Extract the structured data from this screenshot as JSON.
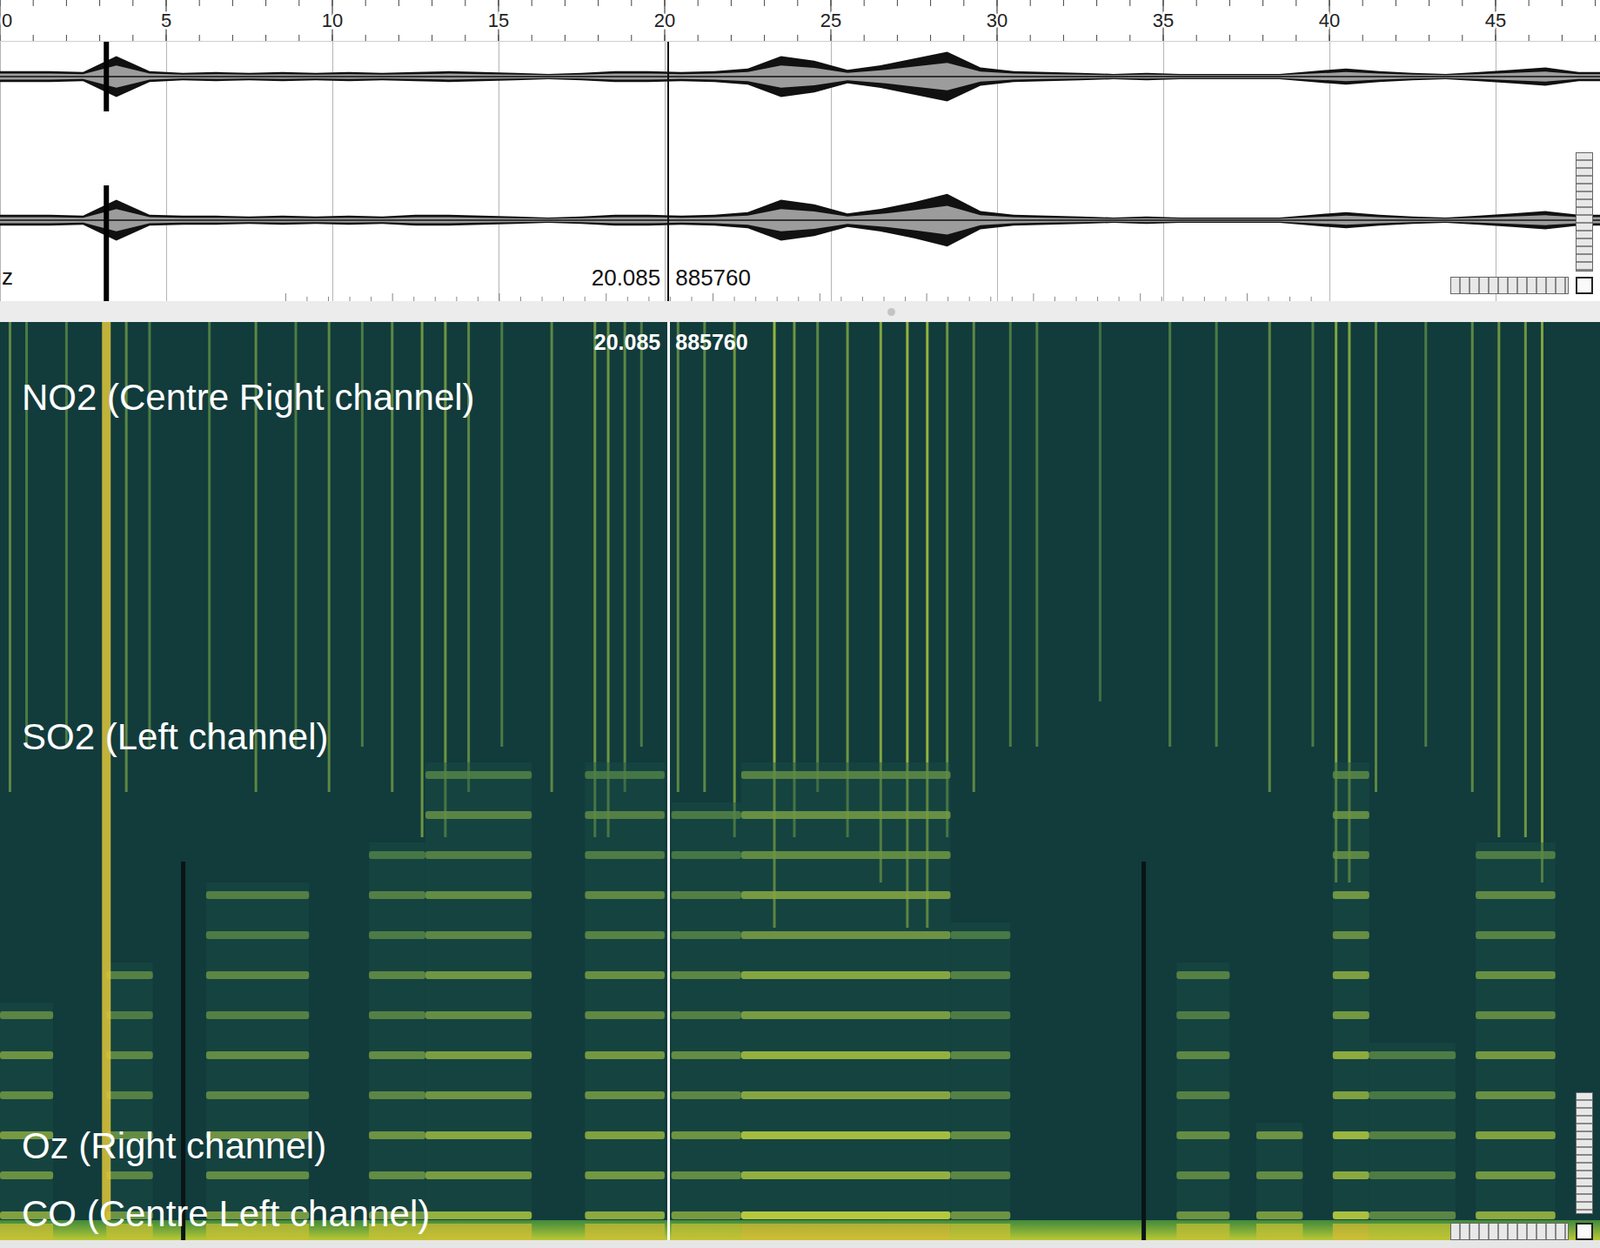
{
  "ruler": {
    "ticks": [
      {
        "label": "0",
        "time": 0
      },
      {
        "label": "5",
        "time": 5
      },
      {
        "label": "10",
        "time": 10
      },
      {
        "label": "15",
        "time": 15
      },
      {
        "label": "20",
        "time": 20
      },
      {
        "label": "25",
        "time": 25
      },
      {
        "label": "30",
        "time": 30
      },
      {
        "label": "35",
        "time": 35
      },
      {
        "label": "40",
        "time": 40
      },
      {
        "label": "45",
        "time": 45
      }
    ]
  },
  "waveform": {
    "unitLabel": "z",
    "channels": [
      {
        "envelope": [
          0.12,
          0.12,
          0.1,
          0.45,
          0.12,
          0.08,
          0.1,
          0.08,
          0.1,
          0.08,
          0.1,
          0.08,
          0.1,
          0.12,
          0.1,
          0.08,
          0.06,
          0.08,
          0.12,
          0.12,
          0.1,
          0.12,
          0.18,
          0.45,
          0.35,
          0.15,
          0.25,
          0.4,
          0.55,
          0.2,
          0.12,
          0.1,
          0.08,
          0.06,
          0.08,
          0.06,
          0.06,
          0.06,
          0.06,
          0.12,
          0.18,
          0.12,
          0.08,
          0.06,
          0.1,
          0.15,
          0.2,
          0.1
        ]
      },
      {
        "envelope": [
          0.12,
          0.12,
          0.1,
          0.45,
          0.12,
          0.1,
          0.1,
          0.08,
          0.1,
          0.08,
          0.1,
          0.08,
          0.12,
          0.12,
          0.1,
          0.08,
          0.06,
          0.08,
          0.12,
          0.12,
          0.1,
          0.12,
          0.18,
          0.45,
          0.35,
          0.15,
          0.25,
          0.4,
          0.58,
          0.2,
          0.12,
          0.1,
          0.08,
          0.06,
          0.08,
          0.06,
          0.06,
          0.06,
          0.06,
          0.12,
          0.18,
          0.12,
          0.08,
          0.06,
          0.1,
          0.15,
          0.2,
          0.12
        ]
      }
    ],
    "spikes": [
      {
        "time": 3.2,
        "level": 1
      }
    ]
  },
  "cursor": {
    "time": "20.085",
    "sample": "885760"
  },
  "spectrogram": {
    "labels": [
      {
        "text": "NO2 (Centre Right channel)"
      },
      {
        "text": "SO2 (Left channel)"
      },
      {
        "text": "Oz (Right channel)"
      },
      {
        "text": "CO (Centre Left channel)"
      }
    ],
    "events": [
      {
        "start": 0,
        "end": 1.6,
        "level": 0.6,
        "harmonics": 6
      },
      {
        "start": 3.2,
        "end": 4.6,
        "level": 0.5,
        "harmonics": 7
      },
      {
        "start": 6.2,
        "end": 9.3,
        "level": 0.55,
        "harmonics": 9
      },
      {
        "start": 11.1,
        "end": 12.8,
        "level": 0.55,
        "harmonics": 10
      },
      {
        "start": 12.8,
        "end": 16,
        "level": 0.7,
        "harmonics": 12
      },
      {
        "start": 17.6,
        "end": 20,
        "level": 0.65,
        "harmonics": 12
      },
      {
        "start": 20.2,
        "end": 22.3,
        "level": 0.55,
        "harmonics": 11
      },
      {
        "start": 22.3,
        "end": 28.6,
        "level": 0.85,
        "harmonics": 12
      },
      {
        "start": 28.6,
        "end": 30.4,
        "level": 0.5,
        "harmonics": 8
      },
      {
        "start": 35.4,
        "end": 37,
        "level": 0.5,
        "harmonics": 7
      },
      {
        "start": 37.8,
        "end": 39.2,
        "level": 0.55,
        "harmonics": 3
      },
      {
        "start": 40.1,
        "end": 41.2,
        "level": 0.8,
        "harmonics": 12
      },
      {
        "start": 41.2,
        "end": 43.8,
        "level": 0.4,
        "harmonics": 5
      },
      {
        "start": 44.4,
        "end": 46.8,
        "level": 0.65,
        "harmonics": 10
      }
    ],
    "clicks": [
      {
        "time": 0.3,
        "level": 0.5
      },
      {
        "time": 0.8,
        "level": 0.4
      },
      {
        "time": 2.0,
        "level": 0.4
      },
      {
        "time": 3.8,
        "level": 0.5
      },
      {
        "time": 4.5,
        "level": 0.4
      },
      {
        "time": 6.3,
        "level": 0.4
      },
      {
        "time": 7.7,
        "level": 0.5
      },
      {
        "time": 8.9,
        "level": 0.4
      },
      {
        "time": 9.9,
        "level": 0.5
      },
      {
        "time": 10.9,
        "level": 0.4
      },
      {
        "time": 11.8,
        "level": 0.5
      },
      {
        "time": 12.7,
        "level": 0.6
      },
      {
        "time": 13.4,
        "level": 0.6
      },
      {
        "time": 14.1,
        "level": 0.5
      },
      {
        "time": 15.1,
        "level": 0.4
      },
      {
        "time": 16.6,
        "level": 0.5
      },
      {
        "time": 17.9,
        "level": 0.6
      },
      {
        "time": 18.3,
        "level": 0.6
      },
      {
        "time": 18.8,
        "level": 0.5
      },
      {
        "time": 19.3,
        "level": 0.4
      },
      {
        "time": 20.4,
        "level": 0.5
      },
      {
        "time": 21.2,
        "level": 0.5
      },
      {
        "time": 22.1,
        "level": 0.6
      },
      {
        "time": 23.3,
        "level": 0.8
      },
      {
        "time": 23.9,
        "level": 0.6
      },
      {
        "time": 24.6,
        "level": 0.5
      },
      {
        "time": 25.5,
        "level": 0.6
      },
      {
        "time": 26.5,
        "level": 0.7
      },
      {
        "time": 27.3,
        "level": 0.8
      },
      {
        "time": 27.9,
        "level": 0.8
      },
      {
        "time": 28.5,
        "level": 0.6
      },
      {
        "time": 29.3,
        "level": 0.5
      },
      {
        "time": 30.4,
        "level": 0.4
      },
      {
        "time": 31.2,
        "level": 0.4
      },
      {
        "time": 33.1,
        "level": 0.3
      },
      {
        "time": 35.2,
        "level": 0.4
      },
      {
        "time": 36.6,
        "level": 0.4
      },
      {
        "time": 38.2,
        "level": 0.5
      },
      {
        "time": 39.5,
        "level": 0.4
      },
      {
        "time": 40.2,
        "level": 0.7
      },
      {
        "time": 40.6,
        "level": 0.7
      },
      {
        "time": 41.4,
        "level": 0.5
      },
      {
        "time": 42.9,
        "level": 0.4
      },
      {
        "time": 44.3,
        "level": 0.5
      },
      {
        "time": 45.1,
        "level": 0.6
      },
      {
        "time": 45.9,
        "level": 0.6
      },
      {
        "time": 46.4,
        "level": 0.7
      }
    ],
    "broadband": [
      {
        "time": 3.2,
        "level": 1
      }
    ],
    "gaps": [
      5.5,
      34.4
    ]
  }
}
